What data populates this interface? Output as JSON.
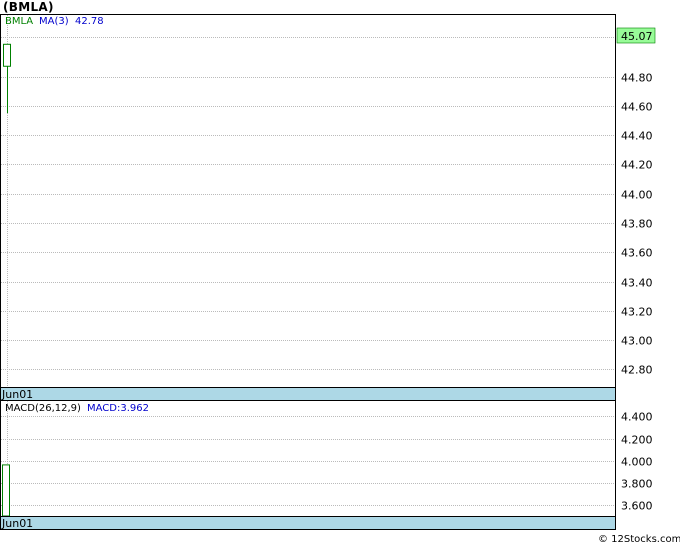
{
  "title": "(BMLA)",
  "footer": "© 12Stocks.com",
  "chart_data": [
    {
      "name": "price",
      "type": "candlestick",
      "ticker": "BMLA",
      "legend": {
        "ticker": "BMLA",
        "ma_label": "MA(3)",
        "ma_value": "42.78"
      },
      "last_price": 45.07,
      "last_price_label": "45.07",
      "ylim": [
        42.68,
        45.22
      ],
      "yticks": [
        42.8,
        43.0,
        43.2,
        43.4,
        43.6,
        43.8,
        44.0,
        44.2,
        44.4,
        44.6,
        44.8
      ],
      "ytick_labels": [
        "42.80",
        "43.00",
        "43.20",
        "43.40",
        "43.60",
        "43.80",
        "44.00",
        "44.20",
        "44.40",
        "44.60",
        "44.80"
      ],
      "x_labels": [
        "Jun01"
      ],
      "candles": [
        {
          "open": 44.87,
          "close": 45.02,
          "high": 45.02,
          "low": 44.55
        }
      ],
      "grid": true
    },
    {
      "name": "macd",
      "type": "bar",
      "legend": {
        "label": "MACD(26,12,9)",
        "value_label": "MACD:3.962"
      },
      "ylim": [
        3.5,
        4.54
      ],
      "yticks": [
        3.6,
        3.8,
        4.0,
        4.2,
        4.4
      ],
      "ytick_labels": [
        "3.600",
        "3.800",
        "4.000",
        "4.200",
        "4.400"
      ],
      "x_labels": [
        "Jun01"
      ],
      "values": [
        3.962
      ],
      "grid": true
    }
  ],
  "colors": {
    "up": "#008000",
    "grid": "#bbbbbb",
    "date_bar": "#add8e6",
    "last_price_bg": "#98fb98",
    "legend_ticker": "#008000",
    "legend_ma": "#0000cc",
    "macd_label": "#000000",
    "macd_value": "#0000cc"
  }
}
